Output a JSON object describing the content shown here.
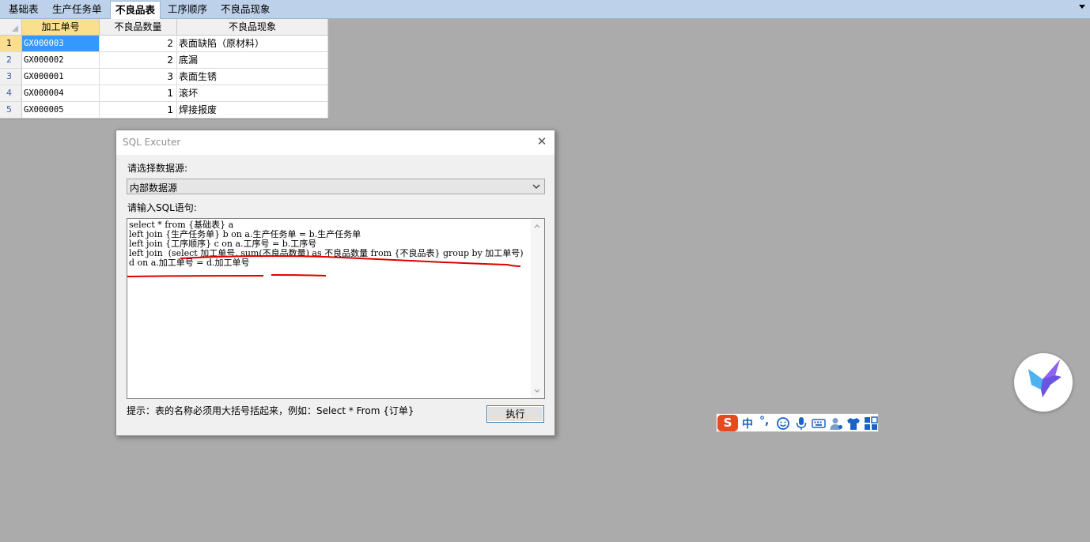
{
  "tabs": [
    {
      "label": "基础表",
      "active": false
    },
    {
      "label": "生产任务单",
      "active": false
    },
    {
      "label": "不良品表",
      "active": true
    },
    {
      "label": "工序顺序",
      "active": false
    },
    {
      "label": "不良品现象",
      "active": false
    }
  ],
  "grid": {
    "columns": [
      "加工单号",
      "不良品数量",
      "不良品现象"
    ],
    "rows": [
      {
        "num": "1",
        "id": "GX000003",
        "qty": "2",
        "phenomenon": "表面缺陷（原材料）",
        "selected": true
      },
      {
        "num": "2",
        "id": "GX000002",
        "qty": "2",
        "phenomenon": "底漏"
      },
      {
        "num": "3",
        "id": "GX000001",
        "qty": "3",
        "phenomenon": "表面生锈"
      },
      {
        "num": "4",
        "id": "GX000004",
        "qty": "1",
        "phenomenon": "滚坏"
      },
      {
        "num": "5",
        "id": "GX000005",
        "qty": "1",
        "phenomenon": "焊接报废"
      }
    ]
  },
  "dialog": {
    "title": "SQL Excuter",
    "close": "✕",
    "datasource_label": "请选择数据源:",
    "datasource_value": "内部数据源",
    "sql_label": "请输入SQL语句:",
    "sql_text": "select * from {基础表} a\nleft join {生产任务单} b on a.生产任务单 = b.生产任务单\nleft join {工序顺序} c on a.工序号 = b.工序号\nleft join  (select 加工单号, sum(不良品数量) as 不良品数量 from {不良品表} group by 加工单号) d on a.加工单号 = d.加工单号",
    "hint": "提示：表的名称必须用大括号括起来，例如：Select * From {订单}",
    "execute_button": "执行"
  },
  "ime": {
    "logo": "S",
    "mode": "中",
    "punct": "°,"
  },
  "colors": {
    "tab_strip": "#bdd1ea",
    "header_selected": "#fbdf8f",
    "cell_selected": "#3399ff",
    "background": "#ababab",
    "annotation_red": "#e00000",
    "ime_blue": "#1a63c5",
    "ime_orange": "#e84a1f"
  }
}
